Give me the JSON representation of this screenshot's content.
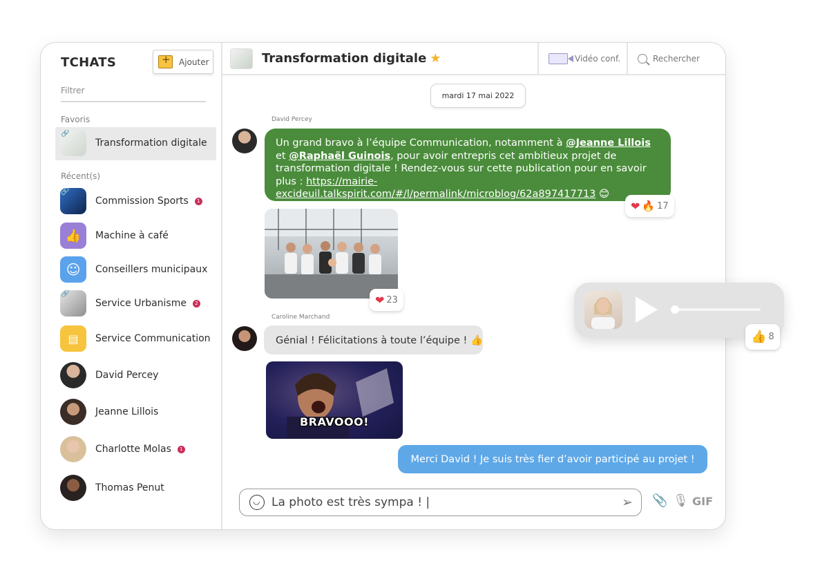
{
  "sidebar": {
    "title": "TCHATS",
    "add_label": "Ajouter",
    "filter_placeholder": "Filtrer",
    "favorites_label": "Favoris",
    "favorites": [
      {
        "label": "Transformation digitale"
      }
    ],
    "recent_label": "Récent(s)",
    "recents": [
      {
        "label": "Commission Sports",
        "badge": "1"
      },
      {
        "label": "Machine à café",
        "badge": ""
      },
      {
        "label": "Conseillers municipaux",
        "badge": ""
      },
      {
        "label": "Service Urbanisme",
        "badge": "2"
      },
      {
        "label": "Service Communication",
        "badge": ""
      },
      {
        "label": "David Percey",
        "badge": ""
      },
      {
        "label": "Jeanne Lillois",
        "badge": ""
      },
      {
        "label": "Charlotte Molas",
        "badge": "1"
      },
      {
        "label": "Thomas Penut",
        "badge": ""
      }
    ]
  },
  "header": {
    "title": "Transformation digitale",
    "video_label": "Vidéo conf.",
    "search_placeholder": "Rechercher"
  },
  "conversation": {
    "date": "mardi 17 mai 2022",
    "msg1": {
      "sender": "David Percey",
      "text_a": "Un grand bravo à l’équipe Communication, notamment à ",
      "mention1": "@Jeanne Lillois",
      "text_b": " et ",
      "mention2": "@Raphaël Guinois",
      "text_c": ", pour avoir entrepris cet ambitieux projet de transformation digitale ! Rendez-vous sur cette publication pour en savoir plus : ",
      "link": "https://mairie-excideuil.talkspirit.com/#/l/permalink/microblog/62a897417713",
      "emoji": "😊",
      "reaction_count": "17"
    },
    "photo_reaction_count": "23",
    "msg2": {
      "sender": "Caroline Marchand",
      "text": "Génial ! Félicitations à toute l’équipe ! 👍"
    },
    "gif_caption": "BRAVOOO!",
    "msg3": {
      "text": "Merci David ! Je suis très fier d’avoir participé au projet !"
    },
    "audio_reaction_count": "8"
  },
  "composer": {
    "value": "La photo est très sympa ! |",
    "gif_label": "GIF"
  },
  "colors": {
    "green_bubble": "#4a8c3b",
    "blue_bubble": "#5ea8e8",
    "badge": "#c9305a",
    "star": "#f4b52c"
  }
}
